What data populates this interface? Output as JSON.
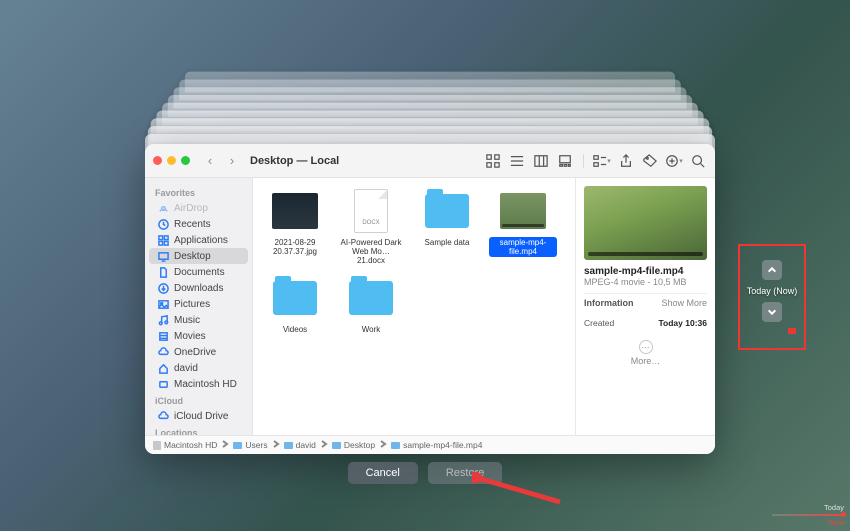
{
  "window": {
    "title": "Desktop — Local"
  },
  "sidebar": {
    "sections": [
      {
        "header": "Favorites",
        "items": [
          {
            "icon": "airdrop",
            "label": "AirDrop",
            "muted": true
          },
          {
            "icon": "clock",
            "label": "Recents"
          },
          {
            "icon": "grid",
            "label": "Applications"
          },
          {
            "icon": "desktop",
            "label": "Desktop",
            "selected": true
          },
          {
            "icon": "doc",
            "label": "Documents"
          },
          {
            "icon": "download",
            "label": "Downloads"
          },
          {
            "icon": "image",
            "label": "Pictures"
          },
          {
            "icon": "music",
            "label": "Music"
          },
          {
            "icon": "film",
            "label": "Movies"
          },
          {
            "icon": "cloud",
            "label": "OneDrive"
          },
          {
            "icon": "home",
            "label": "david"
          },
          {
            "icon": "hd",
            "label": "Macintosh HD"
          }
        ]
      },
      {
        "header": "iCloud",
        "items": [
          {
            "icon": "cloud",
            "label": "iCloud Drive"
          }
        ]
      },
      {
        "header": "Locations",
        "items": []
      }
    ]
  },
  "files": [
    {
      "type": "image",
      "name": "2021-08-29 20.37.37.jpg"
    },
    {
      "type": "docx",
      "name": "AI-Powered Dark Web Mo…21.docx",
      "badge": "DOCX"
    },
    {
      "type": "folder",
      "name": "Sample data"
    },
    {
      "type": "video",
      "name": "sample-mp4-file.mp4",
      "selected": true
    },
    {
      "type": "folder",
      "name": "Videos"
    },
    {
      "type": "folder",
      "name": "Work"
    }
  ],
  "preview": {
    "name": "sample-mp4-file.mp4",
    "sub": "MPEG-4 movie - 10,5 MB",
    "info_header": "Information",
    "show_more": "Show More",
    "created_label": "Created",
    "created_value": "Today 10:36",
    "more": "More…"
  },
  "pathbar": [
    "Macintosh HD",
    "Users",
    "david",
    "Desktop",
    "sample-mp4-file.mp4"
  ],
  "footer": {
    "cancel": "Cancel",
    "restore": "Restore"
  },
  "timeline_nav": {
    "label": "Today (Now)"
  },
  "timeline": {
    "top_label": "Today",
    "bottom_label": "Now"
  }
}
